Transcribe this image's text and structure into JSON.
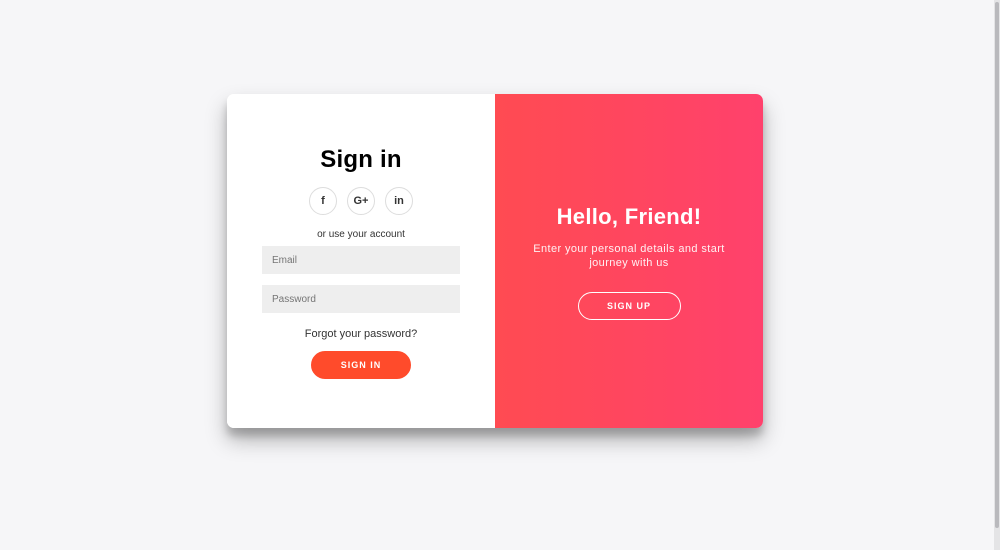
{
  "signin": {
    "title": "Sign in",
    "socials": [
      {
        "icon": "facebook-icon",
        "glyph": "f"
      },
      {
        "icon": "google-plus-icon",
        "glyph": "G+"
      },
      {
        "icon": "linkedin-icon",
        "glyph": "in"
      }
    ],
    "alt_text": "or use your account",
    "email_placeholder": "Email",
    "password_placeholder": "Password",
    "forgot_link": "Forgot your password?",
    "submit_label": "SIGN IN"
  },
  "overlay": {
    "title": "Hello, Friend!",
    "description": "Enter your personal details and start journey with us",
    "signup_label": "SIGN UP"
  },
  "colors": {
    "accent": "#ff4b2b",
    "gradient_start": "#ff4b52",
    "gradient_end": "#ff416c",
    "field_bg": "#eeeeee",
    "page_bg": "#f6f6f8"
  }
}
